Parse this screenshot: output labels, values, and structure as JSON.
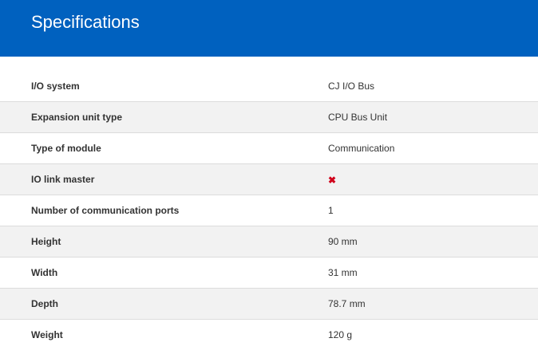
{
  "header": {
    "title": "Specifications"
  },
  "colors": {
    "header_bg": "#0061bf",
    "alt_row_bg": "#f2f2f2",
    "cross": "#d0021b"
  },
  "specs": [
    {
      "label": "I/O system",
      "value": "CJ I/O Bus"
    },
    {
      "label": "Expansion unit type",
      "value": "CPU Bus Unit"
    },
    {
      "label": "Type of module",
      "value": "Communication"
    },
    {
      "label": "IO link master",
      "value": "",
      "icon": "cross-icon"
    },
    {
      "label": "Number of communication ports",
      "value": "1"
    },
    {
      "label": "Height",
      "value": "90 mm"
    },
    {
      "label": "Width",
      "value": "31 mm"
    },
    {
      "label": "Depth",
      "value": "78.7 mm"
    },
    {
      "label": "Weight",
      "value": "120 g"
    }
  ]
}
